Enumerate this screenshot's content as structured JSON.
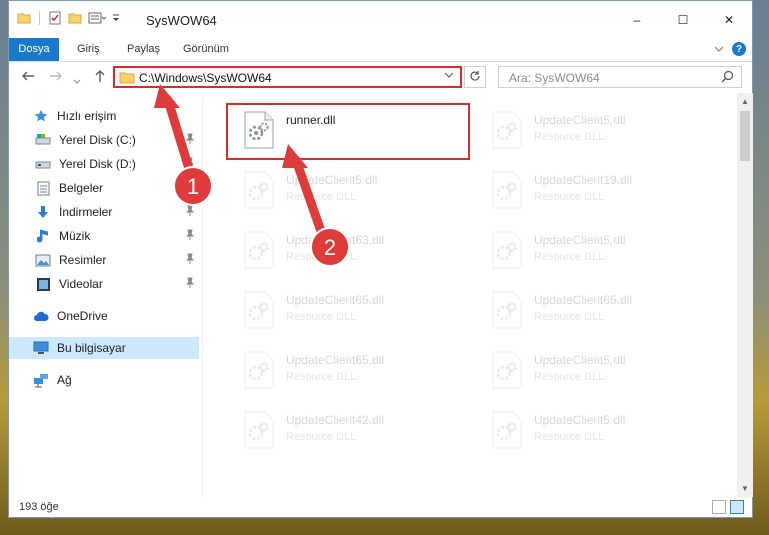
{
  "window": {
    "title": "SysWOW64",
    "caption": {
      "minimize": "–",
      "maximize": "☐",
      "close": "✕"
    }
  },
  "ribbon": {
    "tabs": [
      "Dosya",
      "Giriş",
      "Paylaş",
      "Görünüm"
    ],
    "file_color": "#1979ca",
    "help": "?"
  },
  "nav": {
    "address": "C:\\Windows\\SysWOW64",
    "search_placeholder": "Ara: SysWOW64"
  },
  "sidebar": {
    "quick_access": "Hızlı erişim",
    "items": [
      {
        "label": "Yerel Disk (C:)",
        "icon": "drive-icon",
        "pinned": true
      },
      {
        "label": "Yerel Disk (D:)",
        "icon": "drive-icon",
        "pinned": true
      },
      {
        "label": "Belgeler",
        "icon": "documents-icon",
        "pinned": true
      },
      {
        "label": "İndirmeler",
        "icon": "download-icon",
        "pinned": true
      },
      {
        "label": "Müzik",
        "icon": "music-icon",
        "pinned": true
      },
      {
        "label": "Resimler",
        "icon": "pictures-icon",
        "pinned": true
      },
      {
        "label": "Videolar",
        "icon": "videos-icon",
        "pinned": true
      }
    ],
    "onedrive": "OneDrive",
    "this_pc": "Bu bilgisayar",
    "network": "Ağ"
  },
  "files": {
    "main": {
      "name": "runner.dll",
      "type": ""
    },
    "faded": [
      {
        "name": "UpdateClient5.dll",
        "type": "Resource DLL"
      },
      {
        "name": "UpdateClient5.dll",
        "type": "Resource DLL"
      },
      {
        "name": "UpdateClient19.dll",
        "type": "Resource DLL"
      },
      {
        "name": "UpdateClient63.dll",
        "type": "Resource DLL"
      },
      {
        "name": "UpdateClient5.dll",
        "type": "Resource DLL"
      },
      {
        "name": "UpdateClient65.dll",
        "type": "Resource DLL"
      },
      {
        "name": "UpdateClient65.dll",
        "type": "Resource DLL"
      },
      {
        "name": "UpdateClient65.dll",
        "type": "Resource DLL"
      },
      {
        "name": "UpdateClient5.dll",
        "type": "Resource DLL"
      },
      {
        "name": "UpdateClient42.dll",
        "type": "Resource DLL"
      },
      {
        "name": "UpdateClient5.dll",
        "type": "Resource DLL"
      }
    ]
  },
  "status": {
    "count": "193 öğe"
  },
  "annotations": {
    "step1": "1",
    "step2": "2",
    "color": "#e03b3b"
  }
}
